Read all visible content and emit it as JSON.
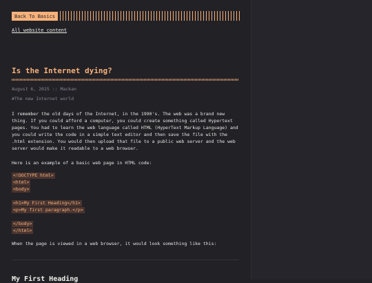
{
  "nav": {
    "back_label": "Back To Basics",
    "all_link": "All website content"
  },
  "post": {
    "title": "Is the Internet dying?",
    "meta": "August 6, 2025 :: Mackan",
    "tag": "#The new Internet world",
    "paragraph1": "I remember the old days of the Internet, in the 1990's. The web was a brand new thing. If you could afford a computer, you could create something called Hypertext pages. You had to learn the web language called HTML (HyperText Markup Language) and you could write the code in a simple text editor and then save the file with the .html extension. You would then upload that file to a public web server and the web server would make it readable to a web browser.",
    "paragraph2": "Here is an example of a basic web page in HTML code:",
    "code_lines": [
      "<!DOCTYPE html>",
      "<html>",
      "<body>",
      "",
      "<h1>My First Heading</h1>",
      "<p>My first paragraph.</p>",
      "",
      "</body>",
      "</html>"
    ],
    "paragraph3": "When the page is viewed in a web browser, it would look something like this:",
    "rendered_heading": "My First Heading"
  },
  "colors": {
    "accent": "#f6b17a",
    "background": "#222126",
    "code_bg": "#4a3530"
  }
}
